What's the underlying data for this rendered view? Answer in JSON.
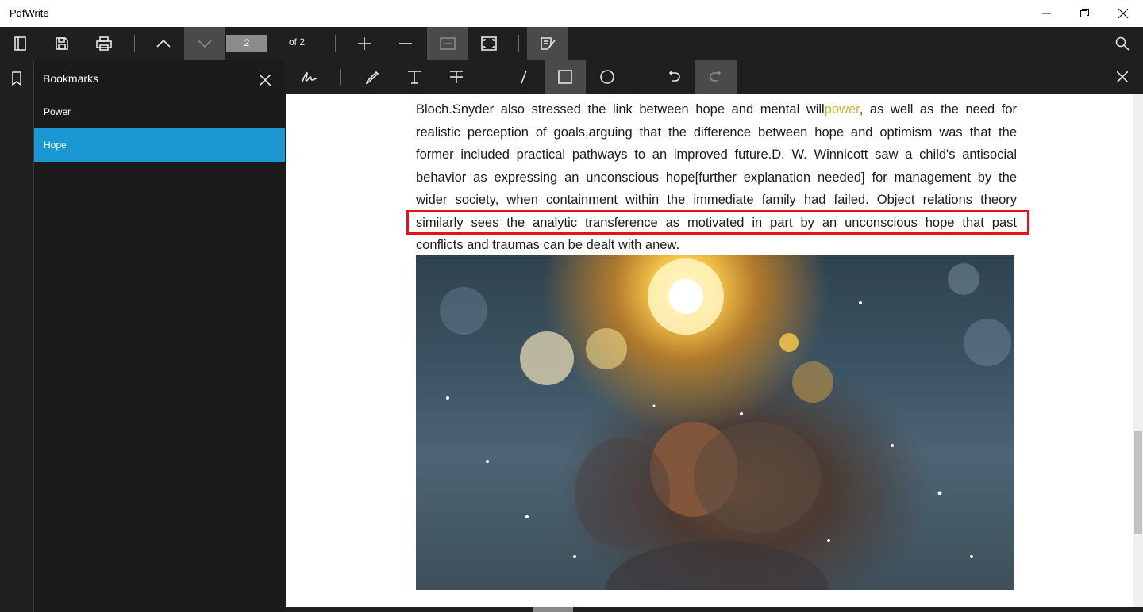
{
  "window": {
    "title": "PdfWrite",
    "minimize_icon": "minimize-icon",
    "restore_icon": "restore-icon",
    "close_icon": "close-icon"
  },
  "toolbar": {
    "items": [
      "sidebar-toggle-icon",
      "save-icon",
      "print-icon",
      "chevron-up-icon",
      "chevron-down-icon",
      "zoom-in-icon",
      "zoom-out-icon",
      "fit-width-icon",
      "fit-page-icon",
      "annotate-icon",
      "search-icon"
    ],
    "page_current": "2",
    "page_total_label": "of 2"
  },
  "bookmarks": {
    "title": "Bookmarks",
    "items": [
      {
        "label": "Power",
        "selected": false
      },
      {
        "label": "Hope",
        "selected": true
      }
    ],
    "selected_color": "#1b97d3"
  },
  "annotation_toolbar": {
    "items": [
      "signature-icon",
      "highlighter-icon",
      "text-icon",
      "strikethrough-icon",
      "line-icon",
      "rectangle-icon",
      "ellipse-icon",
      "undo-icon",
      "redo-icon",
      "close-icon"
    ],
    "active_tool": "rectangle"
  },
  "document": {
    "lines": [
      {
        "before": "Bloch.Snyder also stressed the link between hope and mental will",
        "highlight": "power",
        "after": ", as well as the need for"
      },
      {
        "before": "realistic perception of goals,arguing that the difference between hope and optimism was that the"
      },
      {
        "before": "former included practical pathways to an improved future.D. W. Winnicott saw a child's antisocial"
      },
      {
        "before": "behavior as expressing an unconscious hope[further explanation needed] for management by the"
      },
      {
        "before": "wider society, when containment within the immediate family had failed. Object relations theory"
      },
      {
        "before": "similarly sees the analytic transference as motivated in part by an unconscious hope that past"
      },
      {
        "before": "conflicts and traumas can be dealt with anew."
      }
    ],
    "highlight_color": "#c9b53a",
    "annotation_box_color": "#e8101a"
  }
}
